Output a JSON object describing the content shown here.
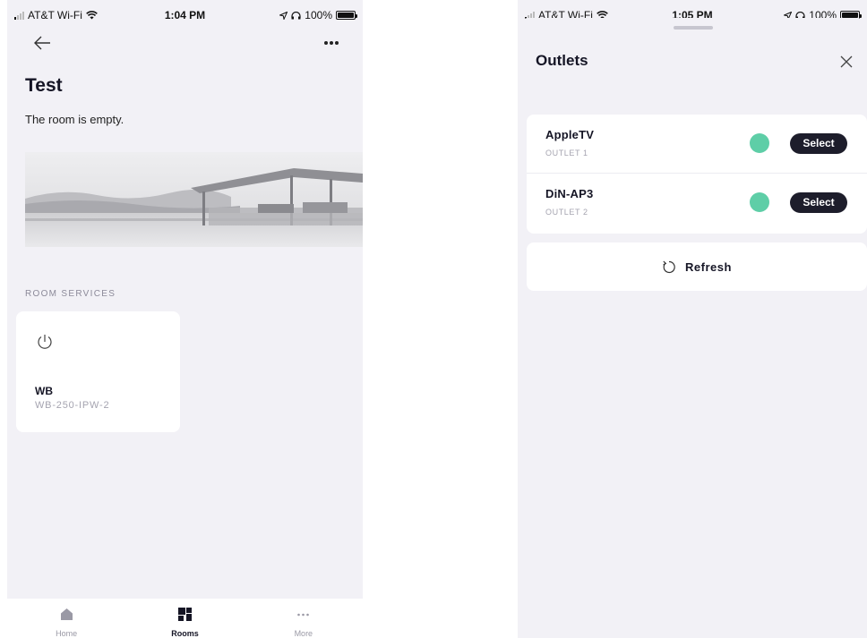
{
  "status_left": {
    "carrier": "AT&T Wi-Fi",
    "time": "1:04 PM",
    "battery": "100%"
  },
  "status_right": {
    "carrier": "AT&T Wi-Fi",
    "time": "1:05 PM",
    "battery": "100%"
  },
  "room": {
    "title": "Test",
    "empty_text": "The room is empty.",
    "section_label": "ROOM SERVICES",
    "services": [
      {
        "name": "WB",
        "model": "WB-250-IPW-2",
        "icon": "power-icon"
      }
    ]
  },
  "tabbar": {
    "tabs": [
      {
        "label": "Home",
        "icon": "home-icon",
        "active": false
      },
      {
        "label": "Rooms",
        "icon": "rooms-grid-icon",
        "active": true
      },
      {
        "label": "More",
        "icon": "more-dots-icon",
        "active": false
      }
    ]
  },
  "outlets_sheet": {
    "title": "Outlets",
    "outlets": [
      {
        "name": "AppleTV",
        "sub": "OUTLET 1",
        "status_color": "#5ecea7",
        "button": "Select"
      },
      {
        "name": "DiN-AP3",
        "sub": "OUTLET 2",
        "status_color": "#5ecea7",
        "button": "Select"
      }
    ],
    "refresh_label": "Refresh"
  },
  "colors": {
    "background": "#f2f1f6",
    "card": "#ffffff",
    "accent_dark": "#1d1d2b",
    "status_green": "#5ecea7"
  }
}
